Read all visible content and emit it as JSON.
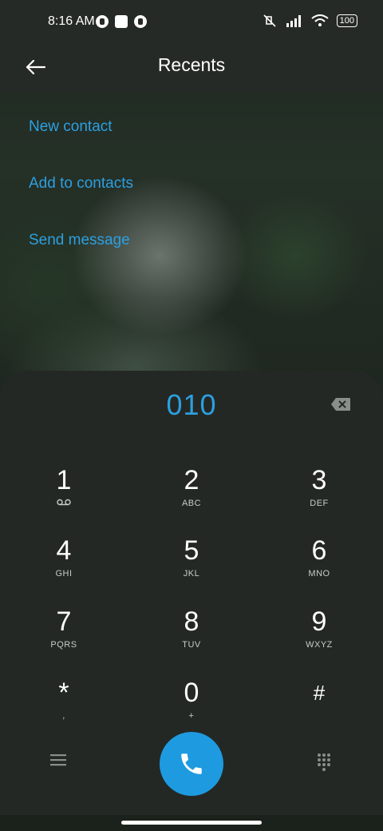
{
  "status_bar": {
    "time": "8:16 AM",
    "battery": "100",
    "icons": [
      "notification-icon",
      "square-icon",
      "notification-icon",
      "mute-icon",
      "signal-icon",
      "wifi-icon"
    ]
  },
  "header": {
    "title": "Recents",
    "back_icon": "arrow-left-icon"
  },
  "actions": [
    {
      "label": "New contact"
    },
    {
      "label": "Add to contacts"
    },
    {
      "label": "Send message"
    }
  ],
  "dialpad": {
    "number": "010",
    "keys": [
      {
        "digit": "1",
        "letters": ""
      },
      {
        "digit": "2",
        "letters": "ABC"
      },
      {
        "digit": "3",
        "letters": "DEF"
      },
      {
        "digit": "4",
        "letters": "GHI"
      },
      {
        "digit": "5",
        "letters": "JKL"
      },
      {
        "digit": "6",
        "letters": "MNO"
      },
      {
        "digit": "7",
        "letters": "PQRS"
      },
      {
        "digit": "8",
        "letters": "TUV"
      },
      {
        "digit": "9",
        "letters": "WXYZ"
      },
      {
        "digit": "*",
        "letters": ","
      },
      {
        "digit": "0",
        "letters": "+"
      },
      {
        "digit": "#",
        "letters": ""
      }
    ]
  },
  "colors": {
    "accent": "#2d9fe0",
    "call_button": "#1e9be0",
    "dialpad_bg": "#242825",
    "header_bg": "#262a26"
  }
}
